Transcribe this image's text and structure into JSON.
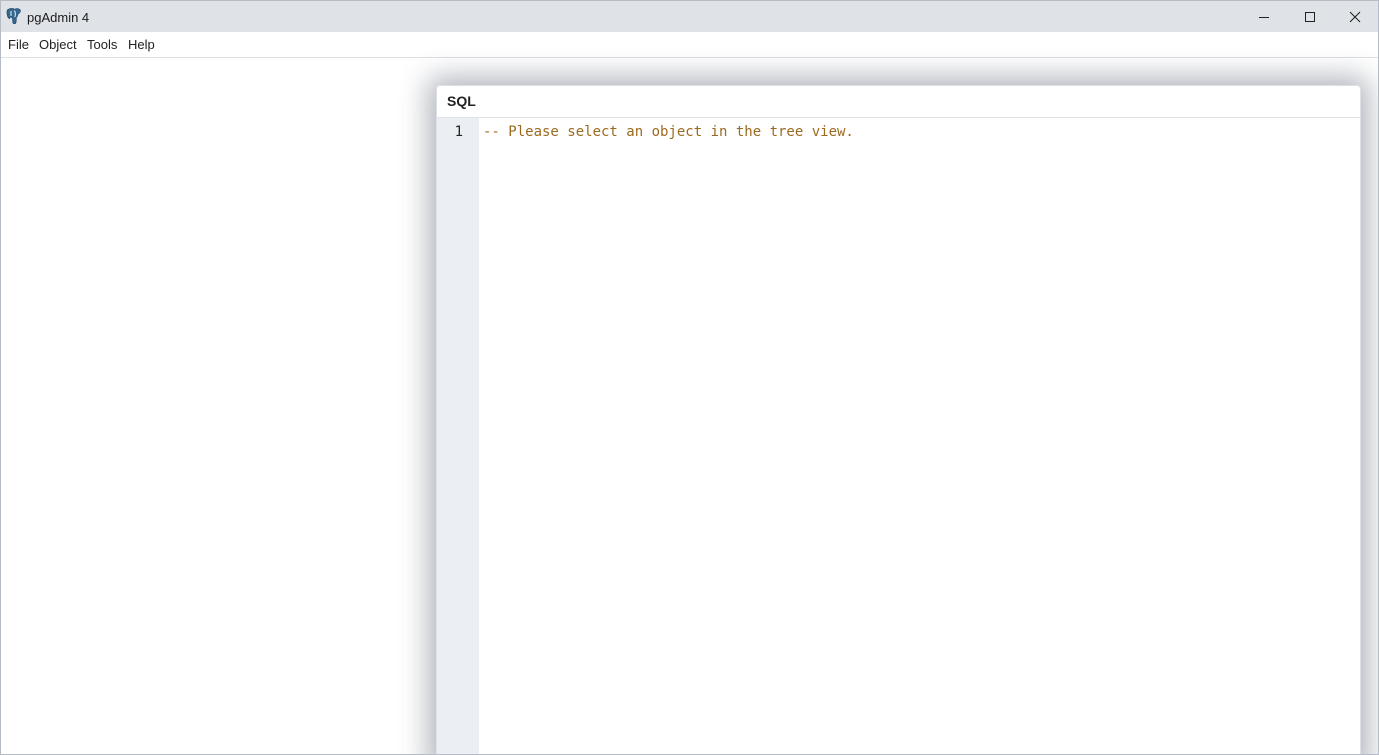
{
  "window": {
    "title": "pgAdmin 4",
    "icon": "postgres-elephant-icon",
    "controls": [
      "minimize-icon",
      "maximize-icon",
      "close-icon"
    ]
  },
  "menu": {
    "items": [
      {
        "label": "File"
      },
      {
        "label": "Object"
      },
      {
        "label": "Tools"
      },
      {
        "label": "Help"
      }
    ]
  },
  "sql_panel": {
    "title": "SQL",
    "line_number": "1",
    "code": "-- Please select an object in the tree view.",
    "comment_color": "#9c6a1f"
  }
}
